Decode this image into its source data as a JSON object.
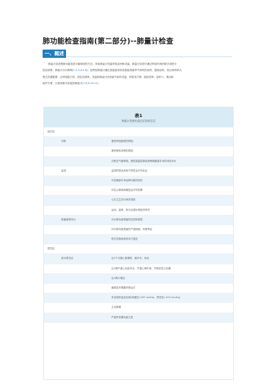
{
  "page": {
    "title": "肺功能检查指南(第二部分)--肺量计检查",
    "section_label": "一、概述",
    "intro_lines": [
      "肺量计检查是肺功能检查中最常用的方法，采用肺量计测量呼吸容积和流量。肺量计检查可通过呼吸时间的数字或积分",
      "相互转换，肺量计分为两种",
      "是过关键数基，比呼吸阻力低，测定容易快，流量型肺量计则测量气体的流量、呼吸流力等。能检查率，容积少、清洁和",
      "维护方便，已逐渐取代容量型肺量计"
    ],
    "intro_line2_rest": "：容积型肺量计通过测量密闭系统直接测量呼气体积的容积，直接反映、但比例体积大，",
    "intro_ref1": "[1,2,3,4,5,6]",
    "intro_ref2": "[7,8,9,10,11]"
  },
  "table": {
    "number": "表1",
    "caption": "肺量计检查的适应证和禁忌证",
    "rows": [
      {
        "c1": "适应证",
        "c2": "",
        "c3": ""
      },
      {
        "c1": "",
        "c2": "诊断",
        "c3": "鉴别呼吸困难的原因"
      },
      {
        "c1": "",
        "c2": "",
        "c3": "鉴别慢性咳嗽的原因"
      },
      {
        "c1": "",
        "c2": "",
        "c3": "诊断支气管哮喘、慢性阻塞性肺疾病等胸腹部手术的术前评价"
      },
      {
        "c1": "",
        "c2": "监测",
        "c3": "监测药物及其他干预性治疗的反应"
      },
      {
        "c1": "",
        "c2": "",
        "c3": "评估胸部手术后肺功能的变化"
      },
      {
        "c1": "",
        "c2": "",
        "c3": "评估心肺疾病康复治疗的效果"
      },
      {
        "c1": "",
        "c2": "",
        "c3": "公共卫生流行病学调查"
      },
      {
        "c1": "",
        "c2": "",
        "c3": "运动、高原、航天及潜水等医学研究"
      },
      {
        "c1": "",
        "c2": "损害致残评价",
        "c3": "评价肺功能损害的性质和类型"
      },
      {
        "c1": "",
        "c2": "",
        "c3": "评价肺功能损害的严重程度，判断预后"
      },
      {
        "c1": "",
        "c2": "",
        "c3": "职业性肺疾病劳动力鉴定"
      },
      {
        "c1": "禁忌证",
        "c2": "",
        "c3": ""
      },
      {
        "c1": "",
        "c2": "绝对禁忌证",
        "c3": "近3个月患心肌梗死、脑卒中、休克"
      },
      {
        "c1": "",
        "c2": "",
        "c3": "近4周严重心功能不全、严重心律失常、不稳定性心绞痛"
      },
      {
        "c1": "",
        "c2": "",
        "c3": "近4周大咯血"
      },
      {
        "c1": "",
        "c2": "",
        "c3": "癫痫发作需要药物治疗"
      },
      {
        "c1": "",
        "c2": "",
        "c3": "未控制的高血压病(收缩压>200 mmHg、舒张压>100 mmHg)"
      },
      {
        "c1": "",
        "c2": "",
        "c3": "主动脉瘤"
      },
      {
        "c1": "",
        "c2": "",
        "c3": "严重甲状腺功能亢进"
      }
    ]
  }
}
